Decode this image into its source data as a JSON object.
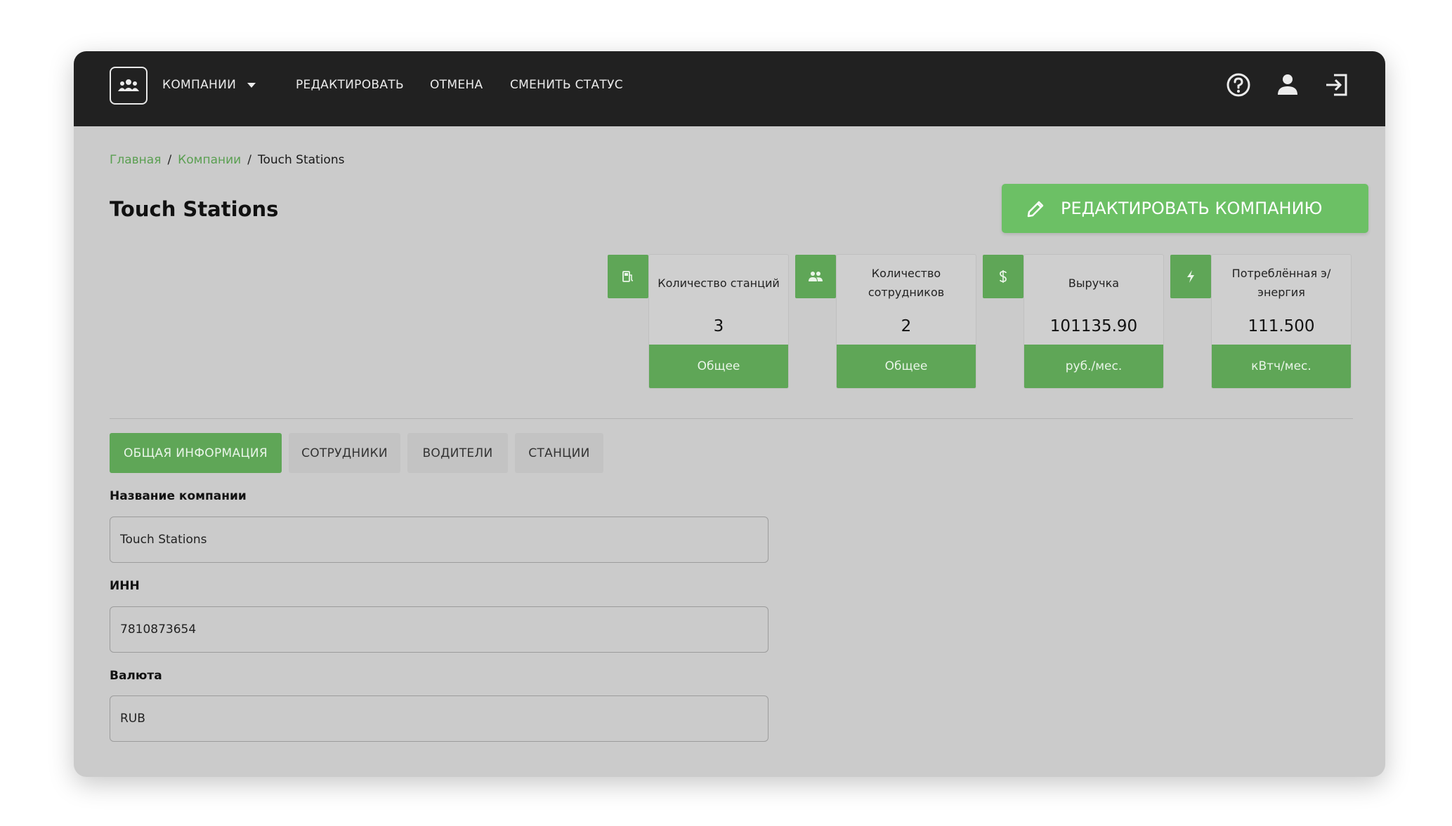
{
  "nav": {
    "companies": "КОМПАНИИ",
    "edit": "РЕДАКТИРОВАТЬ",
    "cancel": "ОТМЕНА",
    "change_status": "СМЕНИТЬ СТАТУС"
  },
  "icons": {
    "logo": "users-group-icon",
    "help": "help-circle-icon",
    "user": "user-icon",
    "logout": "logout-icon",
    "edit": "pencil-icon",
    "stations": "charging-station-icon",
    "employees": "users-icon",
    "revenue": "dollar-icon",
    "energy": "lightning-icon"
  },
  "breadcrumb": {
    "home": "Главная",
    "sep1": "/",
    "companies": "Компании",
    "sep2": "/",
    "current": "Touch Stations"
  },
  "page": {
    "title": "Touch Stations",
    "edit_button": "РЕДАКТИРОВАТЬ КОМПАНИЮ"
  },
  "stats": [
    {
      "label": "Количество станций",
      "value": "3",
      "footer": "Общее"
    },
    {
      "label": "Количество сотрудников",
      "value": "2",
      "footer": "Общее"
    },
    {
      "label": "Выручка",
      "value": "101135.90",
      "footer": "руб./мес."
    },
    {
      "label": "Потреблённая э/энергия",
      "value": "111.500",
      "footer": "кВтч/мес."
    }
  ],
  "tabs": [
    "ОБЩАЯ ИНФОРМАЦИЯ",
    "СОТРУДНИКИ",
    "ВОДИТЕЛИ",
    "СТАНЦИИ"
  ],
  "active_tab": "ОБЩАЯ ИНФОРМАЦИЯ",
  "form": {
    "company_name": {
      "label": "Название компании",
      "value": "Touch Stations"
    },
    "inn": {
      "label": "ИНН",
      "value": "7810873654"
    },
    "currency": {
      "label": "Валюта",
      "value": "RUB"
    }
  },
  "colors": {
    "topbar": "#212121",
    "accent": "#5fa657",
    "edit_button": "#6cc065",
    "background": "#cbcbcb",
    "link": "#5a9f51"
  }
}
